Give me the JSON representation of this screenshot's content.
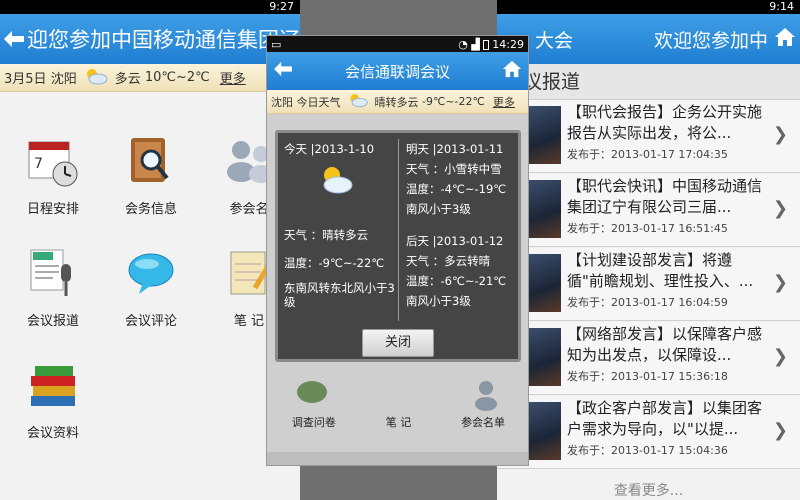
{
  "left": {
    "title": "迎您参加中国移动通信集团辽",
    "weather": {
      "date": "3月5日",
      "city": "沈阳",
      "condition": "多云",
      "temp": "10℃~2℃",
      "more": "更多"
    },
    "grid": [
      {
        "label": "日程安排",
        "icon": "calendar-clock-icon"
      },
      {
        "label": "会务信息",
        "icon": "book-search-icon"
      },
      {
        "label": "参会名",
        "icon": "people-icon"
      },
      {
        "label": "会议报道",
        "icon": "news-microphone-icon"
      },
      {
        "label": "会议评论",
        "icon": "speech-bubble-icon"
      },
      {
        "label": "笔 记",
        "icon": "notepad-pencil-icon"
      },
      {
        "label": "会议资料",
        "icon": "books-stack-icon"
      }
    ]
  },
  "center": {
    "status_time": "14:29",
    "title": "会信通联调会议",
    "weather": {
      "city": "沈阳",
      "label": "今日天气",
      "condition": "晴转多云",
      "temp": "-9℃~-22℃",
      "more": "更多"
    },
    "dialog": {
      "today": {
        "header": "今天 |2013-1-10",
        "weather": "天气 ：晴转多云",
        "temp": "温度：-9℃~-22℃",
        "wind": "东南风转东北风小于3级"
      },
      "tomorrow": {
        "header": "明天 |2013-01-11",
        "weather": "天气 ：小雪转中雪",
        "temp": "温度：-4℃~-19℃",
        "wind": "南风小于3级"
      },
      "after": {
        "header": "后天 |2013-01-12",
        "weather": "天气 ：多云转晴",
        "temp": "温度：-6℃~-21℃",
        "wind": "南风小于3级"
      },
      "close": "关闭"
    },
    "tabs": [
      "调查问卷",
      "笔 记",
      "参会名单"
    ]
  },
  "right": {
    "status_time": "9:14",
    "title_left": "大会",
    "title_right": "欢迎您参加中",
    "section": "议报道",
    "news": [
      {
        "title": "【职代会报告】企务公开实施报告从实际出发，将公...",
        "date": "发布于：2013-01-17 17:04:35"
      },
      {
        "title": "【职代会快讯】中国移动通信集团辽宁有限公司三届...",
        "date": "发布于：2013-01-17 16:51:45"
      },
      {
        "title": "【计划建设部发言】将遵循\"前瞻规划、理性投入、...",
        "date": "发布于：2013-01-17 16:04:59"
      },
      {
        "title": "【网络部发言】以保障客户感知为出发点，以保障设...",
        "date": "发布于：2013-01-17 15:36:18"
      },
      {
        "title": "【政企客户部发言】以集团客户需求为导向，以\"以提...",
        "date": "发布于：2013-01-17 15:04:36"
      }
    ],
    "load_more": "查看更多..."
  },
  "left_status_time": "9:27",
  "colors": {
    "title_blue": "#2a8ad9",
    "weather_bar": "#f5e9c6",
    "dialog_bg": "#454545"
  }
}
